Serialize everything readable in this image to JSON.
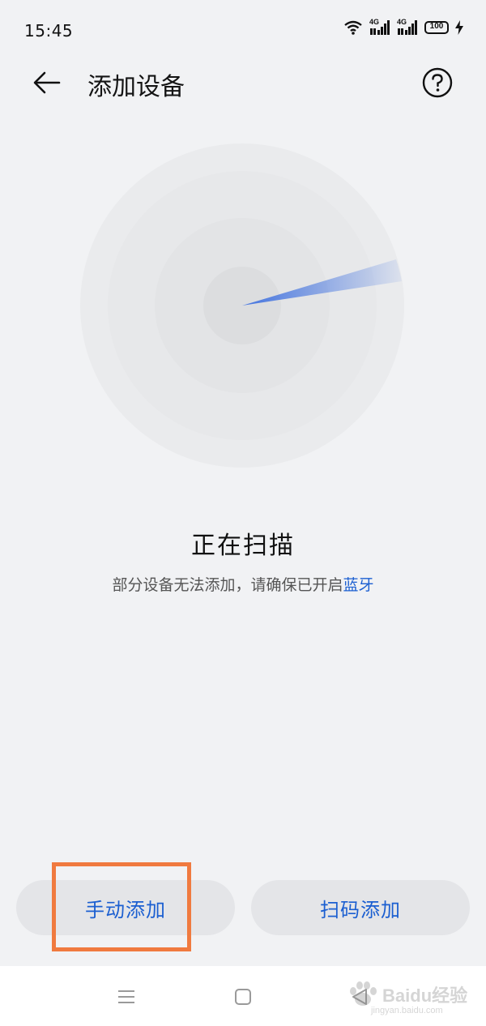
{
  "status_bar": {
    "time": "15:45",
    "signal_1_label": "4G",
    "signal_2_label": "4G",
    "battery": "100"
  },
  "header": {
    "title": "添加设备",
    "back_icon": "arrow-left-icon",
    "help_icon": "question-circle-icon"
  },
  "scan": {
    "title": "正在扫描",
    "hint": "部分设备无法添加，请确保已开启",
    "hint_link": "蓝牙"
  },
  "actions": {
    "manual_add": "手动添加",
    "scan_code_add": "扫码添加"
  },
  "nav": {
    "menu_icon": "menu-icon",
    "home_icon": "home-icon",
    "back_icon": "back-triangle-icon"
  },
  "watermark": {
    "brand": "Bai",
    "brand_suffix": "du",
    "brand_cn": "经验",
    "url": "jingyan.baidu.com"
  },
  "colors": {
    "accent": "#1b5fd1",
    "highlight": "#f07a3f",
    "background": "#f1f2f4"
  }
}
